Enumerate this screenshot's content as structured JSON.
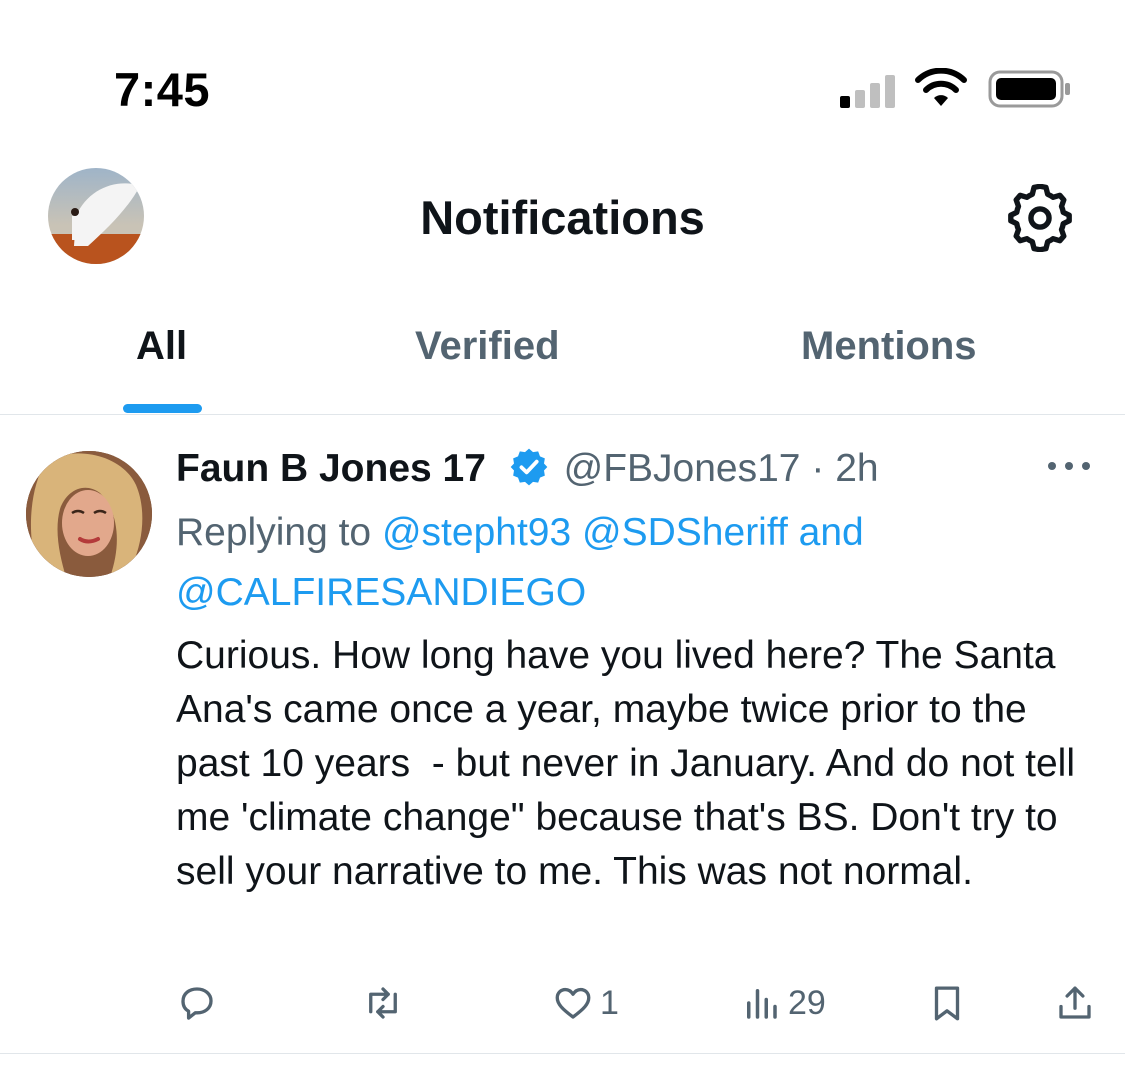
{
  "status_bar": {
    "time": "7:45",
    "signal_icon": "cellular-signal-icon",
    "wifi_icon": "wifi-icon",
    "battery_icon": "battery-icon"
  },
  "header": {
    "title": "Notifications",
    "avatar_icon": "profile-avatar",
    "settings_icon": "gear-icon"
  },
  "tabs": [
    {
      "label": "All",
      "active": true
    },
    {
      "label": "Verified",
      "active": false
    },
    {
      "label": "Mentions",
      "active": false
    }
  ],
  "post": {
    "author_name": "Faun B Jones 17",
    "handle": "@FBJones17",
    "separator": "·",
    "time_ago": "2h",
    "reply_prefix": "Replying to",
    "mentions": [
      "@stepht93",
      "@SDSheriff",
      "@CALFIRESANDIEGO"
    ],
    "mention_joiner": "and",
    "text": "Curious. How long have you lived here? The Santa Ana's came once a year, maybe twice prior to the past 10 years  - but never in January. And do not tell me 'climate change\" because that's BS. Don't try to sell your narrative to me. This was not normal.",
    "actions": {
      "reply_icon": "reply-icon",
      "repost_icon": "repost-icon",
      "like_icon": "heart-icon",
      "like_count": "1",
      "views_icon": "views-icon",
      "view_count": "29",
      "bookmark_icon": "bookmark-icon",
      "share_icon": "share-icon"
    }
  },
  "colors": {
    "accent": "#1d9bf0",
    "text": "#0f1419",
    "secondary": "#536471",
    "divider": "#e1e6ea"
  }
}
